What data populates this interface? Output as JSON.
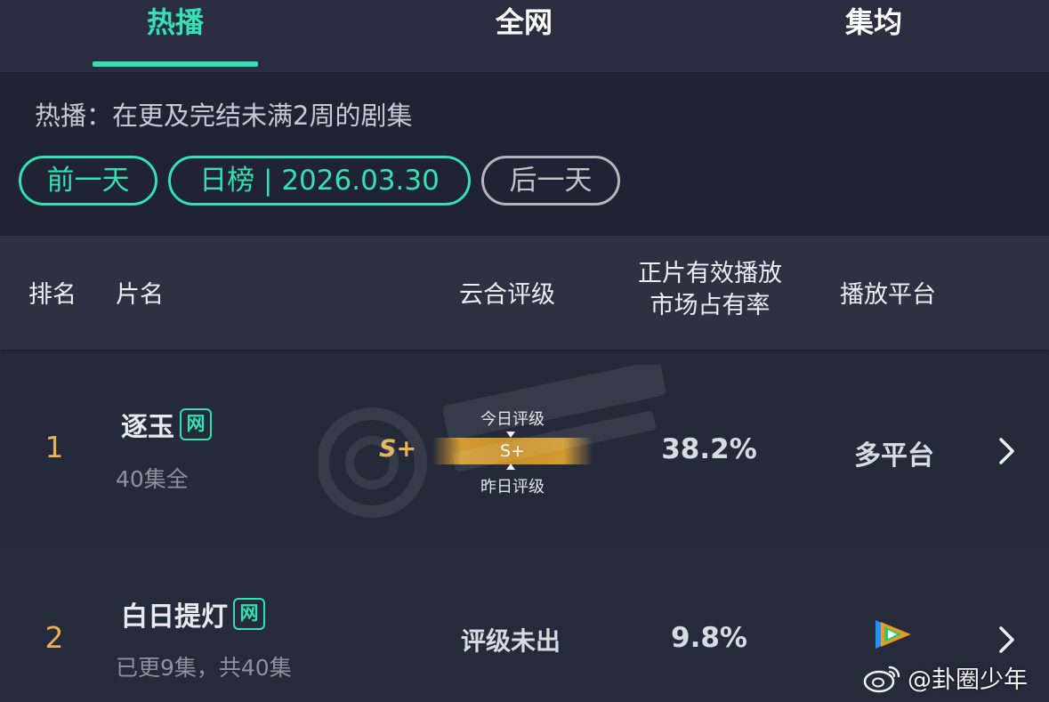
{
  "tabs": [
    {
      "label": "热播",
      "active": true
    },
    {
      "label": "全网",
      "active": false
    },
    {
      "label": "集均",
      "active": false
    }
  ],
  "filter": {
    "description": "热播：在更及完结未满2周的剧集",
    "prev_day": "前一天",
    "date_label": "日榜 | 2026.03.30",
    "next_day": "后一天"
  },
  "table_header": {
    "rank": "排名",
    "title": "片名",
    "rating": "云合评级",
    "share_line1": "正片有效播放",
    "share_line2": "市场占有率",
    "platform": "播放平台"
  },
  "rows": [
    {
      "rank": "1",
      "title": "逐玉",
      "badge": "网",
      "episodes": "40集全",
      "rating": "S+",
      "today_rating_label": "今日评级",
      "rating_bar_value": "S+",
      "yesterday_rating_label": "昨日评级",
      "share": "38.2%",
      "platform": "多平台"
    },
    {
      "rank": "2",
      "title": "白日提灯",
      "badge": "网",
      "episodes": "已更9集，共40集",
      "rating": "评级未出",
      "share": "9.8%",
      "platform_icon": "tencent-video-icon"
    }
  ],
  "watermark": {
    "handle": "@卦圈少年"
  },
  "colors": {
    "accent": "#34e0b4",
    "rank_gold": "#e7b15a",
    "background": "#262a3b"
  }
}
